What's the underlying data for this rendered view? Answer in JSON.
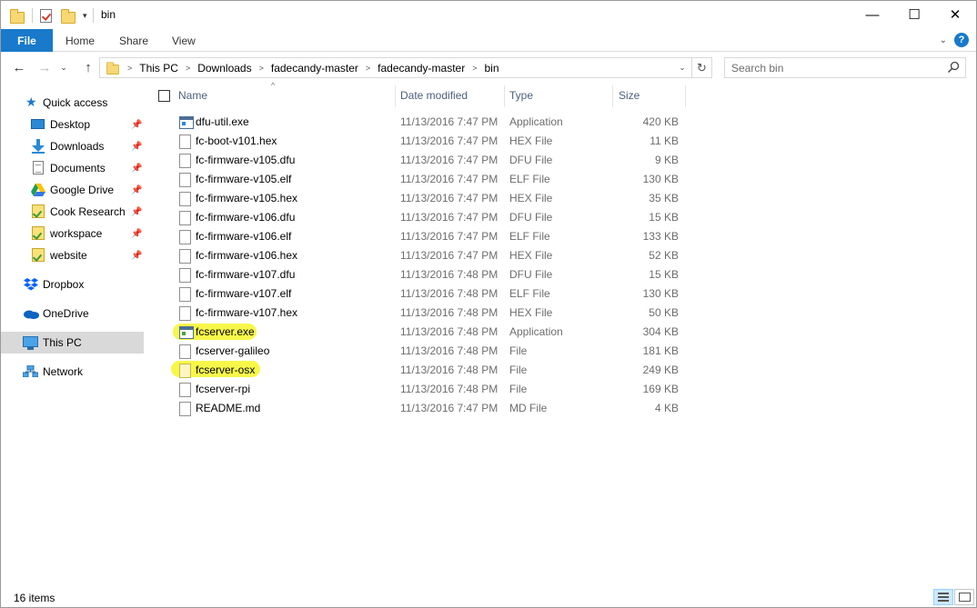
{
  "window": {
    "title": "bin",
    "minimize_glyph": "—",
    "maximize_glyph": "☐",
    "close_glyph": "✕"
  },
  "ribbon": {
    "tabs": [
      {
        "label": "File",
        "active": true
      },
      {
        "label": "Home"
      },
      {
        "label": "Share"
      },
      {
        "label": "View"
      }
    ],
    "accent_color": "#1979ca"
  },
  "address": {
    "crumbs": [
      "This PC",
      "Downloads",
      "fadecandy-master",
      "fadecandy-master",
      "bin"
    ],
    "search_placeholder": "Search bin"
  },
  "navpane": {
    "items": [
      {
        "label": "Quick access",
        "icon": "star-icon"
      },
      {
        "label": "Desktop",
        "icon": "desktop-icon",
        "pinned": true
      },
      {
        "label": "Downloads",
        "icon": "download-arrow-icon",
        "pinned": true
      },
      {
        "label": "Documents",
        "icon": "documents-icon",
        "pinned": true
      },
      {
        "label": "Google Drive",
        "icon": "google-drive-icon",
        "pinned": true
      },
      {
        "label": "Cook Research",
        "icon": "folder-icon",
        "pinned": true
      },
      {
        "label": "workspace",
        "icon": "folder-icon",
        "pinned": true
      },
      {
        "label": "website",
        "icon": "folder-icon",
        "pinned": true
      },
      {
        "label": "Dropbox",
        "icon": "dropbox-icon"
      },
      {
        "label": "OneDrive",
        "icon": "onedrive-icon"
      },
      {
        "label": "This PC",
        "icon": "computer-icon",
        "selected": true
      },
      {
        "label": "Network",
        "icon": "network-icon"
      }
    ]
  },
  "columns": {
    "name": "Name",
    "date": "Date modified",
    "type": "Type",
    "size": "Size"
  },
  "files": [
    {
      "name": "dfu-util.exe",
      "date": "11/13/2016 7:47 PM",
      "type": "Application",
      "size": "420 KB",
      "icon": "exe-icon"
    },
    {
      "name": "fc-boot-v101.hex",
      "date": "11/13/2016 7:47 PM",
      "type": "HEX File",
      "size": "11 KB",
      "icon": "file-icon"
    },
    {
      "name": "fc-firmware-v105.dfu",
      "date": "11/13/2016 7:47 PM",
      "type": "DFU File",
      "size": "9 KB",
      "icon": "file-icon"
    },
    {
      "name": "fc-firmware-v105.elf",
      "date": "11/13/2016 7:47 PM",
      "type": "ELF File",
      "size": "130 KB",
      "icon": "file-icon"
    },
    {
      "name": "fc-firmware-v105.hex",
      "date": "11/13/2016 7:47 PM",
      "type": "HEX File",
      "size": "35 KB",
      "icon": "file-icon"
    },
    {
      "name": "fc-firmware-v106.dfu",
      "date": "11/13/2016 7:47 PM",
      "type": "DFU File",
      "size": "15 KB",
      "icon": "file-icon"
    },
    {
      "name": "fc-firmware-v106.elf",
      "date": "11/13/2016 7:47 PM",
      "type": "ELF File",
      "size": "133 KB",
      "icon": "file-icon"
    },
    {
      "name": "fc-firmware-v106.hex",
      "date": "11/13/2016 7:47 PM",
      "type": "HEX File",
      "size": "52 KB",
      "icon": "file-icon"
    },
    {
      "name": "fc-firmware-v107.dfu",
      "date": "11/13/2016 7:48 PM",
      "type": "DFU File",
      "size": "15 KB",
      "icon": "file-icon"
    },
    {
      "name": "fc-firmware-v107.elf",
      "date": "11/13/2016 7:48 PM",
      "type": "ELF File",
      "size": "130 KB",
      "icon": "file-icon"
    },
    {
      "name": "fc-firmware-v107.hex",
      "date": "11/13/2016 7:48 PM",
      "type": "HEX File",
      "size": "50 KB",
      "icon": "file-icon"
    },
    {
      "name": "fcserver.exe",
      "date": "11/13/2016 7:48 PM",
      "type": "Application",
      "size": "304 KB",
      "icon": "exe-icon",
      "highlighted": true
    },
    {
      "name": "fcserver-galileo",
      "date": "11/13/2016 7:48 PM",
      "type": "File",
      "size": "181 KB",
      "icon": "file-icon"
    },
    {
      "name": "fcserver-osx",
      "date": "11/13/2016 7:48 PM",
      "type": "File",
      "size": "249 KB",
      "icon": "file-icon",
      "highlighted": true
    },
    {
      "name": "fcserver-rpi",
      "date": "11/13/2016 7:48 PM",
      "type": "File",
      "size": "169 KB",
      "icon": "file-icon"
    },
    {
      "name": "README.md",
      "date": "11/13/2016 7:47 PM",
      "type": "MD File",
      "size": "4 KB",
      "icon": "file-icon"
    }
  ],
  "highlight_color": "#f7f74a",
  "status": {
    "item_count": "16 items"
  }
}
